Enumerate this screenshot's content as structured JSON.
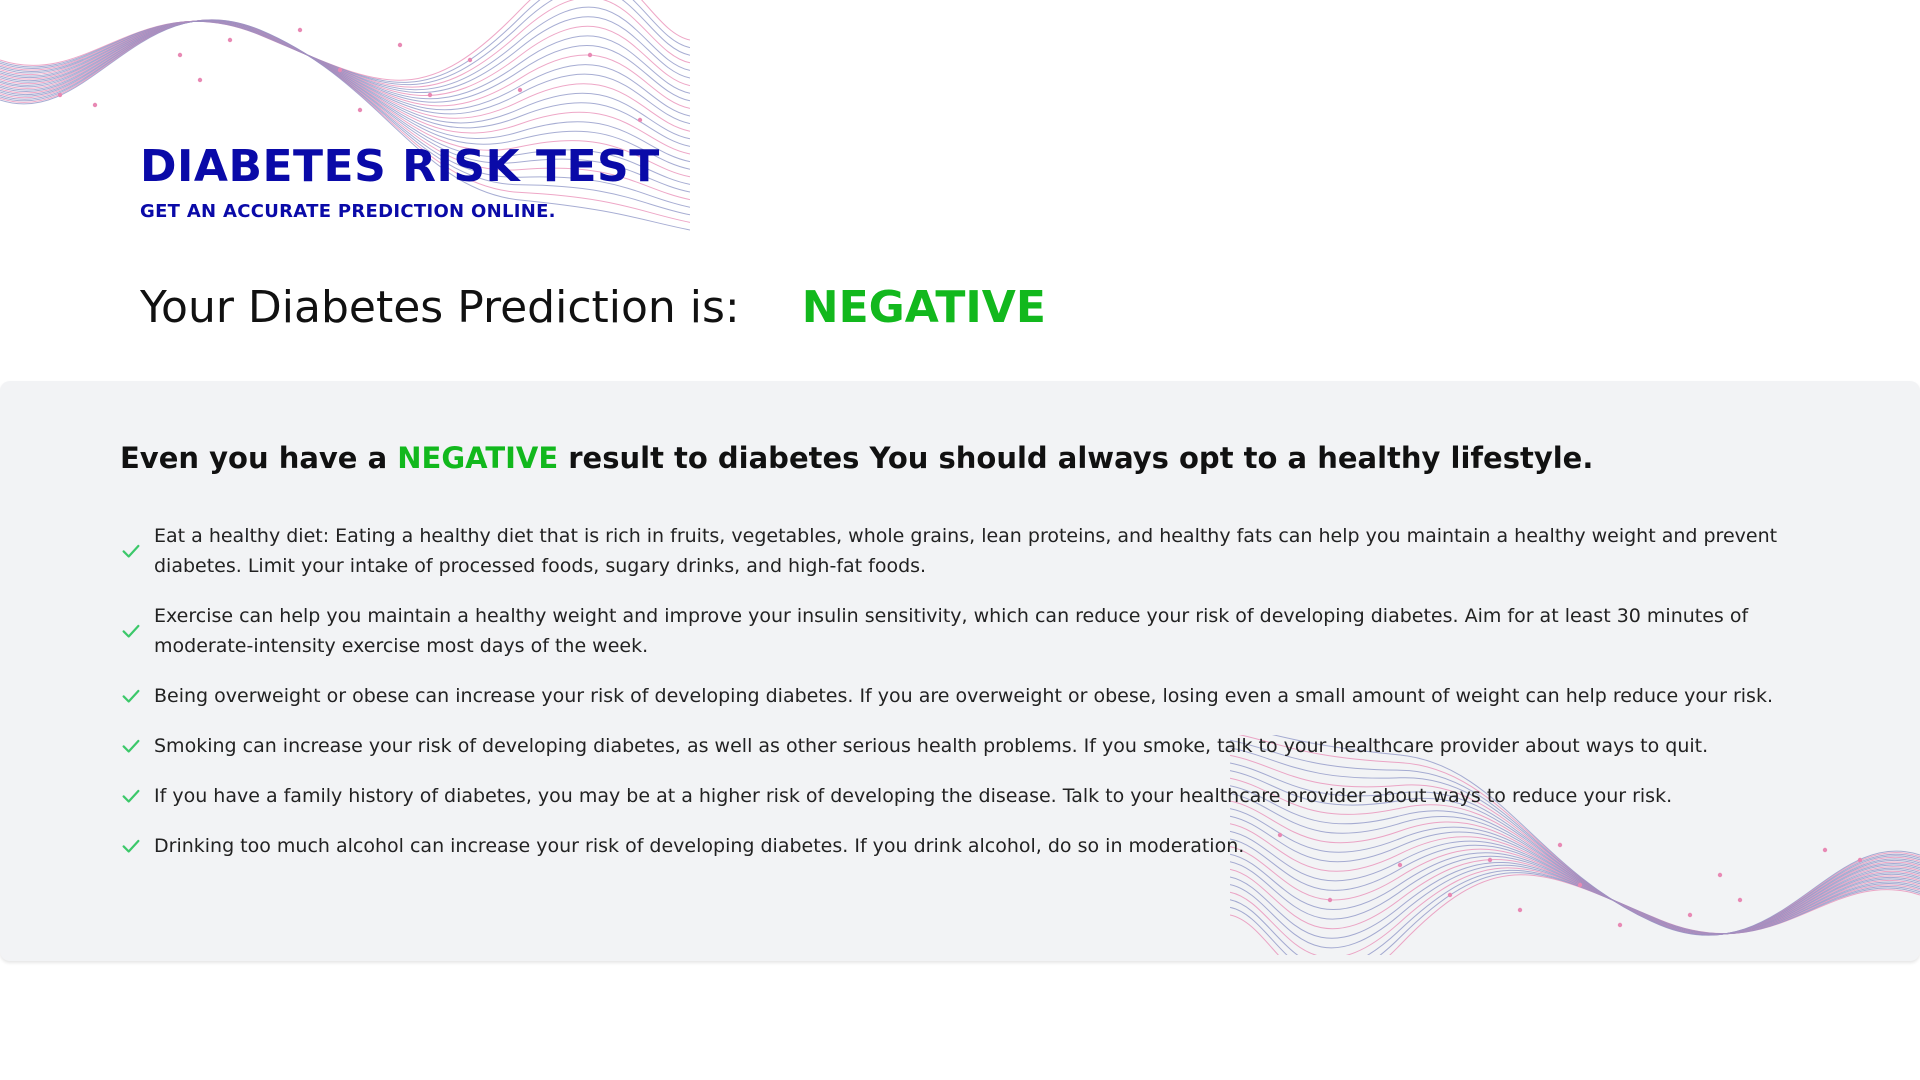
{
  "header": {
    "title": "DIABETES RISK TEST",
    "subtitle": "GET AN ACCURATE PREDICTION ONLINE."
  },
  "prediction": {
    "label": "Your Diabetes Prediction is:",
    "result": "NEGATIVE",
    "result_color": "#12b81d"
  },
  "panel": {
    "heading_before": "Even you have a ",
    "heading_result": "NEGATIVE",
    "heading_after": " result to diabetes You should always opt to a healthy lifestyle.",
    "tips": [
      "Eat a healthy diet: Eating a healthy diet that is rich in fruits, vegetables, whole grains, lean proteins, and healthy fats can help you maintain a healthy weight and prevent diabetes. Limit your intake of processed foods, sugary drinks, and high-fat foods.",
      "Exercise can help you maintain a healthy weight and improve your insulin sensitivity, which can reduce your risk of developing diabetes. Aim for at least 30 minutes of moderate-intensity exercise most days of the week.",
      "Being overweight or obese can increase your risk of developing diabetes. If you are overweight or obese, losing even a small amount of weight can help reduce your risk.",
      "Smoking can increase your risk of developing diabetes, as well as other serious health problems. If you smoke, talk to your healthcare provider about ways to quit.",
      "If you have a family history of diabetes, you may be at a higher risk of developing the disease. Talk to your healthcare provider about ways to reduce your risk.",
      "Drinking too much alcohol can increase your risk of developing diabetes. If you drink alcohol, do so in moderation."
    ],
    "icon": "check-icon"
  },
  "colors": {
    "brand_blue": "#0a0aa8",
    "accent_green": "#12b81d",
    "panel_bg": "#f2f3f5",
    "wave_blue": "#8a91c4",
    "wave_pink": "#e889b4"
  }
}
